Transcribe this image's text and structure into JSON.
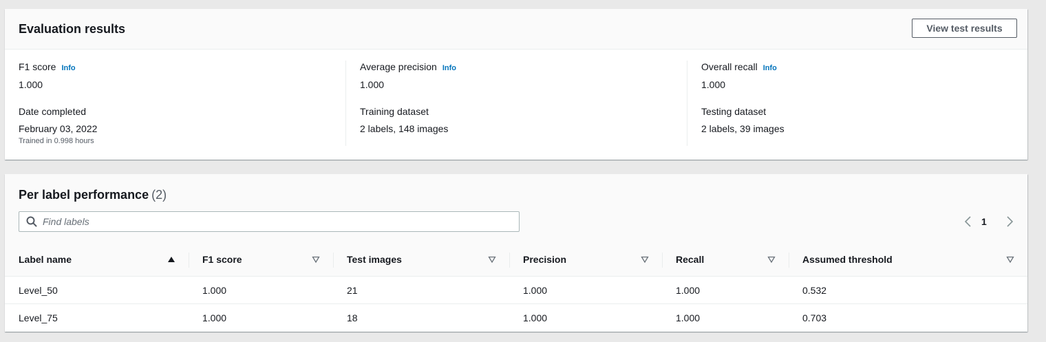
{
  "evaluation": {
    "title": "Evaluation results",
    "view_button": "View test results",
    "info_label": "Info",
    "metrics": {
      "f1_label": "F1 score",
      "f1_value": "1.000",
      "precision_label": "Average precision",
      "precision_value": "1.000",
      "recall_label": "Overall recall",
      "recall_value": "1.000"
    },
    "details": {
      "date_label": "Date completed",
      "date_value": "February 03, 2022",
      "date_sub": "Trained in 0.998 hours",
      "training_label": "Training dataset",
      "training_value": "2 labels, 148 images",
      "testing_label": "Testing dataset",
      "testing_value": "2 labels, 39 images"
    }
  },
  "performance": {
    "title": "Per label performance",
    "count": "(2)",
    "search_placeholder": "Find labels",
    "page": "1",
    "columns": [
      "Label name",
      "F1 score",
      "Test images",
      "Precision",
      "Recall",
      "Assumed threshold"
    ],
    "rows": [
      [
        "Level_50",
        "1.000",
        "21",
        "1.000",
        "1.000",
        "0.532"
      ],
      [
        "Level_75",
        "1.000",
        "18",
        "1.000",
        "1.000",
        "0.703"
      ]
    ]
  }
}
